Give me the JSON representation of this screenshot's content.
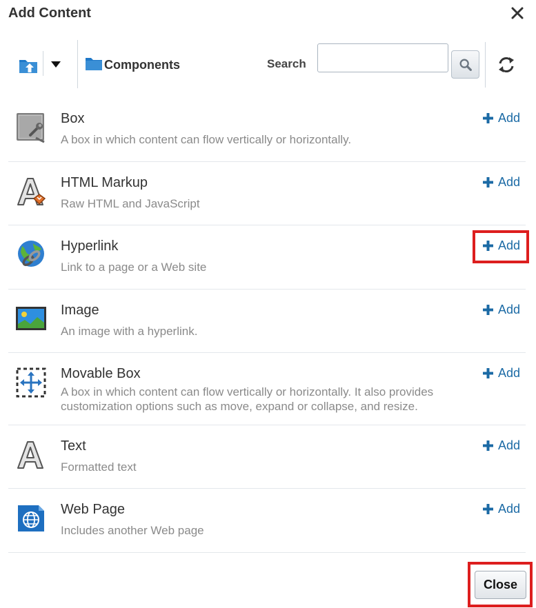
{
  "dialog": {
    "title": "Add Content",
    "close_button_label": "Close"
  },
  "toolbar": {
    "folder_label": "Components",
    "search_label": "Search",
    "search_value": "",
    "search_placeholder": ""
  },
  "items": [
    {
      "name": "Box",
      "description": "A box in which content can flow vertically or horizontally.",
      "add_label": "Add",
      "icon": "box-icon"
    },
    {
      "name": "HTML Markup",
      "description": "Raw HTML and JavaScript",
      "add_label": "Add",
      "icon": "html-markup-icon"
    },
    {
      "name": "Hyperlink",
      "description": "Link to a page or a Web site",
      "add_label": "Add",
      "icon": "hyperlink-icon"
    },
    {
      "name": "Image",
      "description": "An image with a hyperlink.",
      "add_label": "Add",
      "icon": "image-icon"
    },
    {
      "name": "Movable Box",
      "description_line1": "A box in which content can flow vertically or horizontally. It also provides",
      "description_line2": "customization options such as move, expand or collapse, and resize.",
      "add_label": "Add",
      "icon": "movable-box-icon"
    },
    {
      "name": "Text",
      "description": "Formatted text",
      "add_label": "Add",
      "icon": "text-icon"
    },
    {
      "name": "Web Page",
      "description": "Includes another Web page",
      "add_label": "Add",
      "icon": "web-page-icon"
    }
  ],
  "colors": {
    "accent_link": "#1b6aa5",
    "highlight": "#dd1e1e",
    "folder_blue": "#1e78c8"
  }
}
